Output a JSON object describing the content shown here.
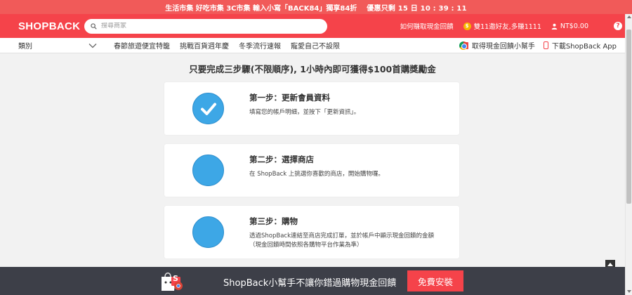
{
  "promo": {
    "text": "生活市集 好吃市集 3C市集 輸入小寫「BACK84」獨享84折",
    "countdown": "優惠只剩 15 日 10 : 39 : 11"
  },
  "header": {
    "logo": "SHOPBACK",
    "search_placeholder": "搜尋商家",
    "how_to_earn": "如何賺取現金回饋",
    "invite": "雙11邀好友,多賺1111",
    "balance": "NT$0.00",
    "help": "?"
  },
  "catbar": {
    "category_label": "類別",
    "links": [
      "春節旅遊便宜特籠",
      "挑戰百貨週年慶",
      "冬季流行速報",
      "寵愛自己不設限"
    ],
    "extension_label": "取得現金回饋小幫手",
    "app_label": "下載ShopBack App"
  },
  "main": {
    "headline": "只要完成三步驟(不限順序), 1小時內即可獲得$100首購獎勵金",
    "steps": [
      {
        "title": "第一步：更新會員資料",
        "desc": "填寫您的帳戶明細，並按下「更新資訊」。",
        "done": true
      },
      {
        "title": "第二步：選擇商店",
        "desc": "在 ShopBack 上挑選你喜歡的商店，開始購物囉。",
        "done": false
      },
      {
        "title": "第三步：購物",
        "desc": "透過ShopBack連結至商店完成訂單，並於帳戶中顯示現金回饋的金額（現金回饋時間依照各購物平台作業為準）",
        "done": false
      }
    ]
  },
  "bottom_banner": {
    "text": "ShopBack小幫手不讓你錯過購物現金回饋",
    "button": "免費安裝",
    "bag_letter": "S"
  },
  "colors": {
    "brand_red": "#f5434a",
    "step_blue": "#3da7e6",
    "banner_dark": "#3d3f48"
  }
}
